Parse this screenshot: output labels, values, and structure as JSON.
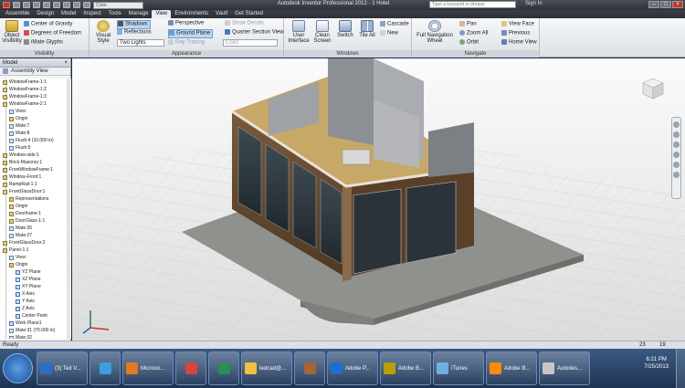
{
  "title_bar": {
    "app_title": "Autodesk Inventor Professional 2012 - 1 Hotel",
    "appearance_combo": "Color",
    "search_placeholder": "Type a keyword or phrase",
    "sign_in": "Sign In"
  },
  "tabs": [
    "Assemble",
    "Design",
    "Model",
    "Inspect",
    "Tools",
    "Manage",
    "View",
    "Environments",
    "Vault",
    "Get Started"
  ],
  "active_tab": "View",
  "ribbon": {
    "visibility": {
      "title": "Visibility",
      "object_visibility": "Object Visibility",
      "center_of_gravity": "Center of Gravity",
      "degrees_of_freedom": "Degrees of Freedom",
      "imate_glyphs": "iMate Glyphs"
    },
    "appearance": {
      "title": "Appearance",
      "visual_style": "Visual Style",
      "shadows": "Shadows",
      "reflections": "Reflections",
      "lighting": "Two Lights",
      "perspective": "Perspective",
      "ground_plane": "Ground Plane",
      "ray_tracing": "Ray Tracing",
      "color_combo": "Color",
      "show_decals": "Show Decals",
      "quarter_section_view": "Quarter Section View"
    },
    "windows": {
      "title": "Windows",
      "user_interface": "User Interface",
      "clean_screen": "Clean Screen",
      "switch": "Switch",
      "tile_all": "Tile All",
      "cascade": "Cascade",
      "new": "New"
    },
    "navigate": {
      "title": "Navigate",
      "full_navigation_wheel": "Full Navigation Wheel",
      "pan": "Pan",
      "zoom_all": "Zoom All",
      "orbit": "Orbit",
      "view_face": "View Face",
      "previous": "Previous",
      "home_view": "Home View"
    }
  },
  "browser": {
    "panel_title": "Model",
    "view_selector": "Assembly View",
    "nodes": [
      "WindowFrame-1:1",
      "WindowFrame-1:2",
      "WindowFrame-1:3",
      "WindowFrame-2:1",
      "View:",
      "Origin",
      "Mate:7",
      "Mate:8",
      "Flush:4 (10.000 in)",
      "Flush:5",
      "Window-side:1",
      "Brick-Masonry:1",
      "FrontWindowFrame:1",
      "Window-Front:1",
      "RampRail-1:1",
      "FrontGlassDoor:1",
      "Representations",
      "Origin",
      "Doorframe:1",
      "DoorGlass-1:1",
      "Mate:26",
      "Mate:27",
      "FrontGlassDoor:2",
      "Panel-1:1",
      "View:",
      "Origin",
      "YZ Plane",
      "XZ Plane",
      "XY Plane",
      "X Axis",
      "Y Axis",
      "Z Axis",
      "Center Point",
      "Work Plane1",
      "Mate:31 (70.000 in)",
      "Mate:32"
    ]
  },
  "status_bar": {
    "text": "Ready",
    "counter_a": "23",
    "counter_b": "19"
  },
  "taskbar": {
    "items": [
      {
        "label": "(3) Ted V...",
        "color": "#2b6fc2"
      },
      {
        "label": "",
        "color": "#3aa0e0"
      },
      {
        "label": "Microso...",
        "color": "#e07b1f"
      },
      {
        "label": "",
        "color": "#d64541"
      },
      {
        "label": "",
        "color": "#2e8b57"
      },
      {
        "label": "tedcad@...",
        "color": "#f0c040"
      },
      {
        "label": "",
        "color": "#a86432"
      },
      {
        "label": "Adobe P...",
        "color": "#1e6fd0"
      },
      {
        "label": "Adobe B...",
        "color": "#b8a000"
      },
      {
        "label": "iTunes",
        "color": "#6fb0e0"
      },
      {
        "label": "Adobe Ill...",
        "color": "#ff8c00"
      },
      {
        "label": "Autodes...",
        "color": "#c7c7c7"
      }
    ],
    "time": "6:21 PM",
    "date": "7/25/2013"
  }
}
